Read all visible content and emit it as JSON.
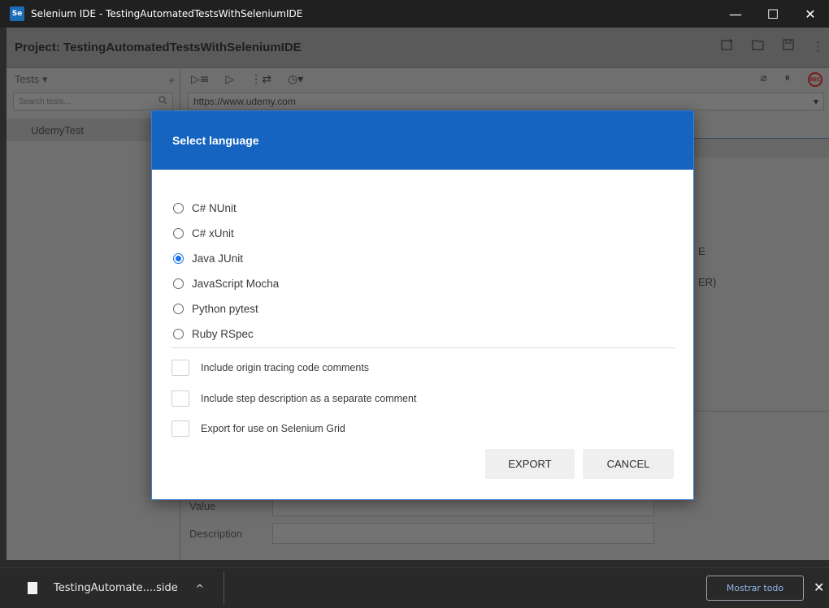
{
  "window": {
    "title": "Selenium IDE - TestingAutomatedTestsWithSeleniumIDE",
    "logo_text": "Se",
    "controls": [
      "—",
      "☐",
      "✕"
    ]
  },
  "project": {
    "label": "Project:  TestingAutomatedTestsWithSeleniumIDE"
  },
  "sidebar": {
    "header": "Tests",
    "header_caret": "▾",
    "add_icon": "+",
    "search_placeholder": "Search tests...",
    "tests": [
      "UdemyTest"
    ]
  },
  "toolbar": {
    "url": "https://www.udemy.com",
    "rec_label": "REC"
  },
  "background": {
    "partial_text_1": "E",
    "partial_text_2": "ER)",
    "field_value_label": "Value",
    "field_description_label": "Description"
  },
  "dialog": {
    "title": "Select language",
    "languages": [
      {
        "label": "C# NUnit",
        "checked": false
      },
      {
        "label": "C# xUnit",
        "checked": false
      },
      {
        "label": "Java JUnit",
        "checked": true
      },
      {
        "label": "JavaScript Mocha",
        "checked": false
      },
      {
        "label": "Python pytest",
        "checked": false
      },
      {
        "label": "Ruby RSpec",
        "checked": false
      }
    ],
    "options": [
      "Include origin tracing code comments",
      "Include step description as a separate comment",
      "Export for use on Selenium Grid"
    ],
    "export_label": "EXPORT",
    "cancel_label": "CANCEL",
    "accent_color": "#1565c0"
  },
  "download_bar": {
    "file_name": "TestingAutomate....side",
    "caret": "^",
    "show_all": "Mostrar todo",
    "close": "✕"
  }
}
